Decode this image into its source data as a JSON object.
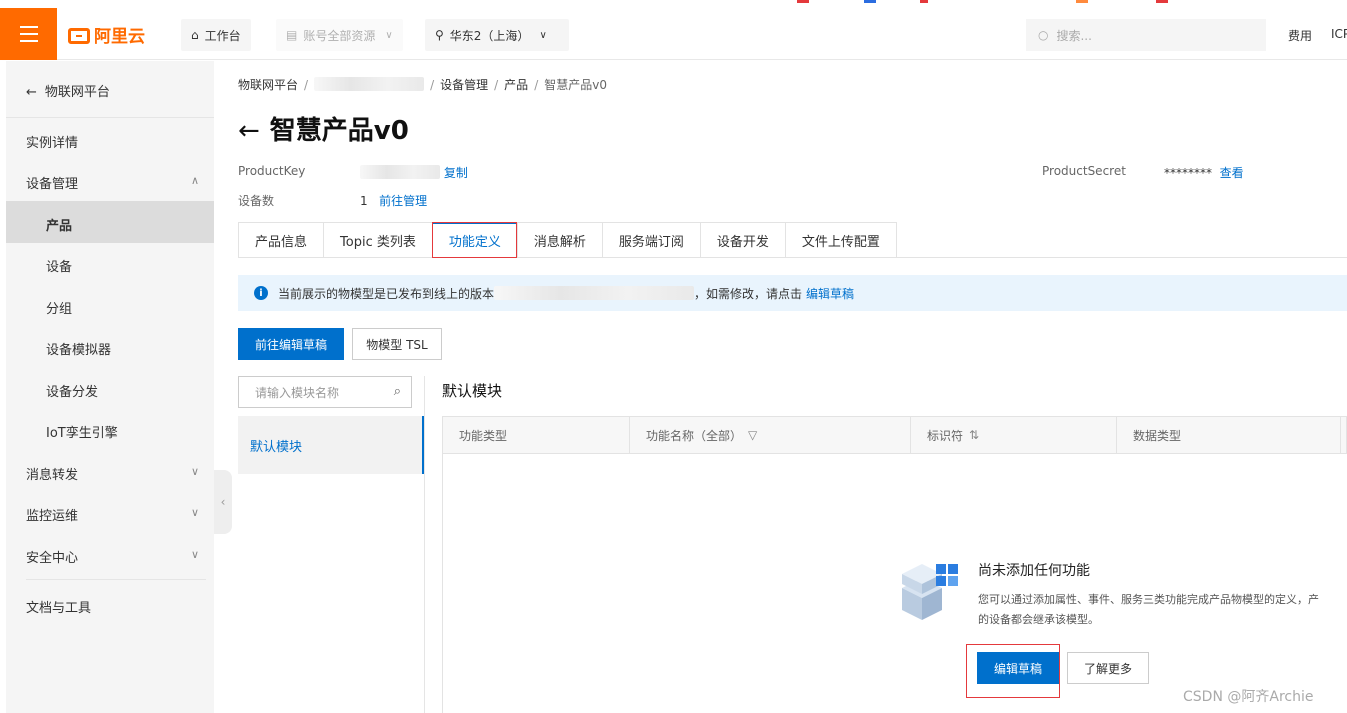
{
  "header": {
    "logo_text": "阿里云",
    "workbench": "工作台",
    "resources": "账号全部资源",
    "region": "华东2（上海）",
    "search_placeholder": "搜索...",
    "fee": "费用",
    "icp": "ICP"
  },
  "sidebar": {
    "back": "物联网平台",
    "instance": "实例详情",
    "device_mgmt": "设备管理",
    "subitems": [
      "产品",
      "设备",
      "分组",
      "设备模拟器",
      "设备分发",
      "IoT孪生引擎"
    ],
    "msg": "消息转发",
    "monitor": "监控运维",
    "security": "安全中心",
    "docs": "文档与工具"
  },
  "breadcrumb": {
    "root": "物联网平台",
    "device_mgmt": "设备管理",
    "product": "产品",
    "current": "智慧产品v0"
  },
  "product": {
    "title": "智慧产品v0",
    "key_label": "ProductKey",
    "copy": "复制",
    "count_label": "设备数",
    "count_value": "1",
    "manage": "前往管理",
    "secret_label": "ProductSecret",
    "secret_value": "********",
    "view": "查看"
  },
  "tabs": [
    "产品信息",
    "Topic 类列表",
    "功能定义",
    "消息解析",
    "服务端订阅",
    "设备开发",
    "文件上传配置"
  ],
  "notice": {
    "text_before": "当前展示的物模型是已发布到线上的版本",
    "text_mid": "，如需修改，请点击",
    "link": "编辑草稿"
  },
  "actions": {
    "edit_draft": "前往编辑草稿",
    "tsl": "物模型 TSL"
  },
  "modules": {
    "search_placeholder": "请输入模块名称",
    "default": "默认模块",
    "title": "默认模块"
  },
  "table": {
    "headers": [
      "功能类型",
      "功能名称（全部）",
      "标识符",
      "数据类型"
    ]
  },
  "empty": {
    "title": "尚未添加任何功能",
    "desc_line1": "您可以通过添加属性、事件、服务三类功能完成产品物模型的定义，产",
    "desc_line2": "的设备都会继承该模型。",
    "edit": "编辑草稿",
    "learn": "了解更多"
  },
  "watermark": "CSDN @阿齐Archie",
  "colors": {
    "accent": "#0070cc",
    "brand": "#ff6a00",
    "highlight": "#e4393c"
  }
}
